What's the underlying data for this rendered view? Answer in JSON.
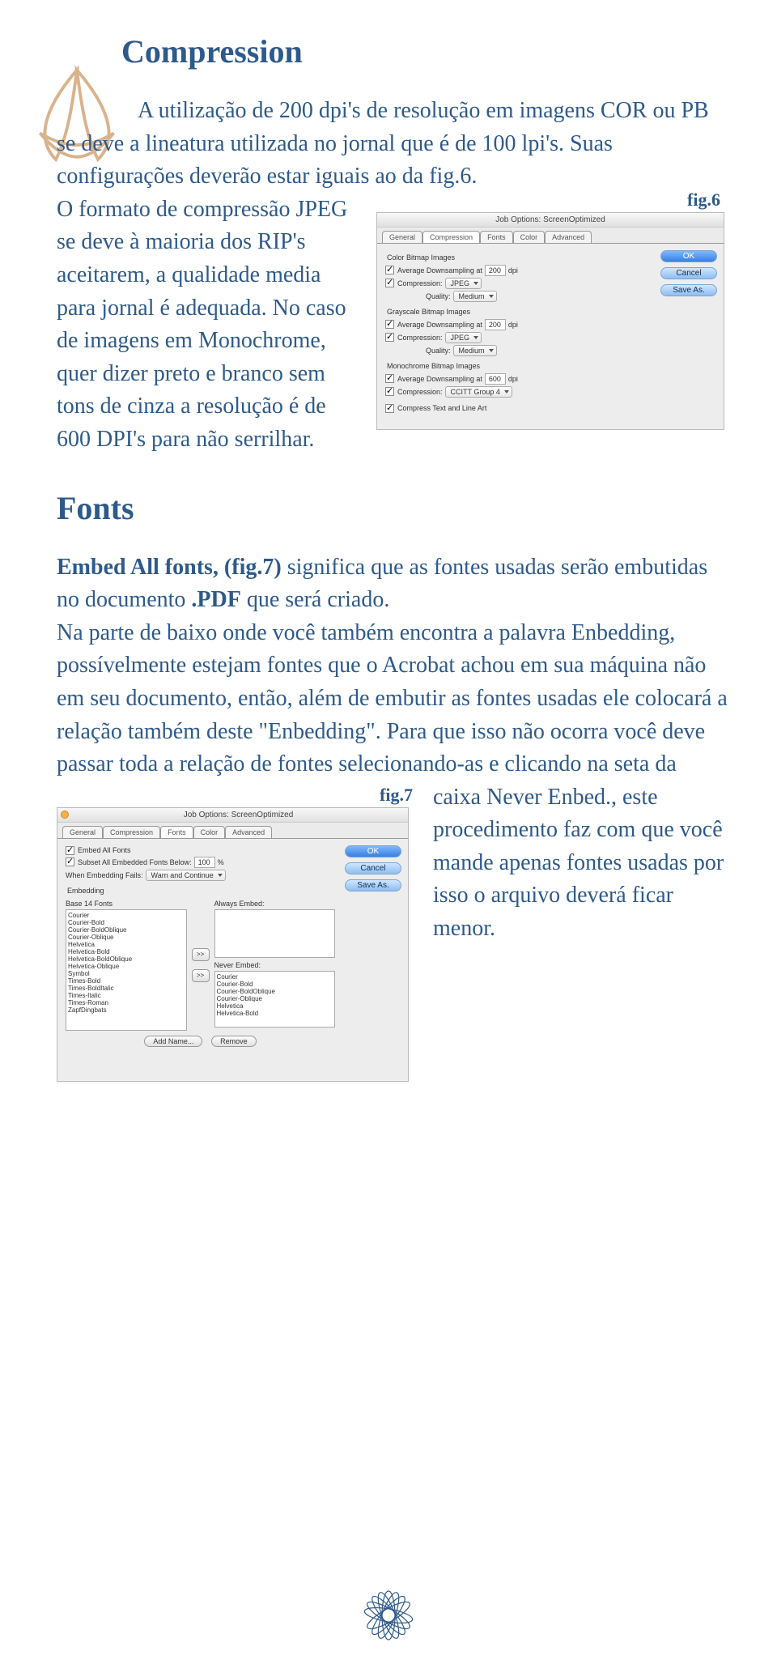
{
  "title": "Compression",
  "p1_part1": "A utilização de 200 dpi's de resolução em imagens COR ou PB se deve a lineatura utilizada no jornal que é de 100 lpi's. Suas configurações deverão estar iguais ao da fig.6.",
  "p1_part2": "O formato de compressão JPEG se deve à maioria dos RIP's aceitarem, a qualidade media para jornal é adequada. No caso de imagens em Monochrome, quer dizer preto e branco sem tons de cinza a resolução é de 600 DPI's para não serrilhar.",
  "section2_title": "Fonts",
  "p2a_bold": "Embed All fonts, (fig.7)",
  "p2a_rest": " significa que as fontes usadas serão embutidas no documento ",
  "p2a_bold2": ".PDF",
  "p2a_rest2": " que será criado.",
  "p2b": "Na parte de baixo onde você também encontra a palavra Enbedding, possívelmente estejam fontes que o Acrobat achou em sua máquina não em seu documento, então, além de embutir as fontes usadas ele colocará a relação também deste \"Enbedding\". Para que isso não ocorra você deve passar toda a relação de fontes selecionando-as e clicando na seta da ",
  "p2c": "caixa Never Enbed., este procedimento faz com que você mande apenas fontes usadas por isso o arquivo deverá ficar menor.",
  "fig6": {
    "label": "fig.6",
    "title": "Job Options: ScreenOptimized",
    "tabs": [
      "General",
      "Compression",
      "Fonts",
      "Color",
      "Advanced"
    ],
    "btns": {
      "ok": "OK",
      "cancel": "Cancel",
      "saveas": "Save As."
    },
    "group1": "Color Bitmap Images",
    "g1_r1": "Average Downsampling at",
    "g1_r1_val": "200",
    "g1_r1_unit": "dpi",
    "g1_r2": "Compression:",
    "g1_r2_val": "JPEG",
    "g1_r3": "Quality:",
    "g1_r3_val": "Medium",
    "group2": "Grayscale Bitmap Images",
    "g2_r1": "Average Downsampling at",
    "g2_r1_val": "200",
    "g2_r1_unit": "dpi",
    "g2_r2": "Compression:",
    "g2_r2_val": "JPEG",
    "g2_r3": "Quality:",
    "g2_r3_val": "Medium",
    "group3": "Monochrome Bitmap Images",
    "g3_r1": "Average Downsampling at",
    "g3_r1_val": "600",
    "g3_r1_unit": "dpi",
    "g3_r2": "Compression:",
    "g3_r2_val": "CCITT Group 4",
    "g4_r1": "Compress Text and Line Art"
  },
  "fig7": {
    "label": "fig.7",
    "title": "Job Options: ScreenOptimized",
    "tabs": [
      "General",
      "Compression",
      "Fonts",
      "Color",
      "Advanced"
    ],
    "btns": {
      "ok": "OK",
      "cancel": "Cancel",
      "saveas": "Save As."
    },
    "r1": "Embed All Fonts",
    "r2": "Subset All Embedded Fonts Below:",
    "r2_val": "100",
    "r2_unit": "%",
    "r3": "When Embedding Fails:",
    "r3_val": "Warn and Continue",
    "emb_label": "Embedding",
    "col1_label": "Base 14 Fonts",
    "col1_items": [
      "Courier",
      "Courier-Bold",
      "Courier-BoldOblique",
      "Courier-Oblique",
      "Helvetica",
      "Helvetica-Bold",
      "Helvetica-BoldOblique",
      "Helvetica-Oblique",
      "Symbol",
      "Times-Bold",
      "Times-BoldItalic",
      "Times-Italic",
      "Times-Roman",
      "ZapfDingbats"
    ],
    "col2_label": "Always Embed:",
    "col3_label": "Never Embed:",
    "col3_items": [
      "Courier",
      "Courier-Bold",
      "Courier-BoldOblique",
      "Courier-Oblique",
      "Helvetica",
      "Helvetica-Bold"
    ],
    "addname": "Add Name...",
    "remove": "Remove",
    "arrow": ">>"
  }
}
